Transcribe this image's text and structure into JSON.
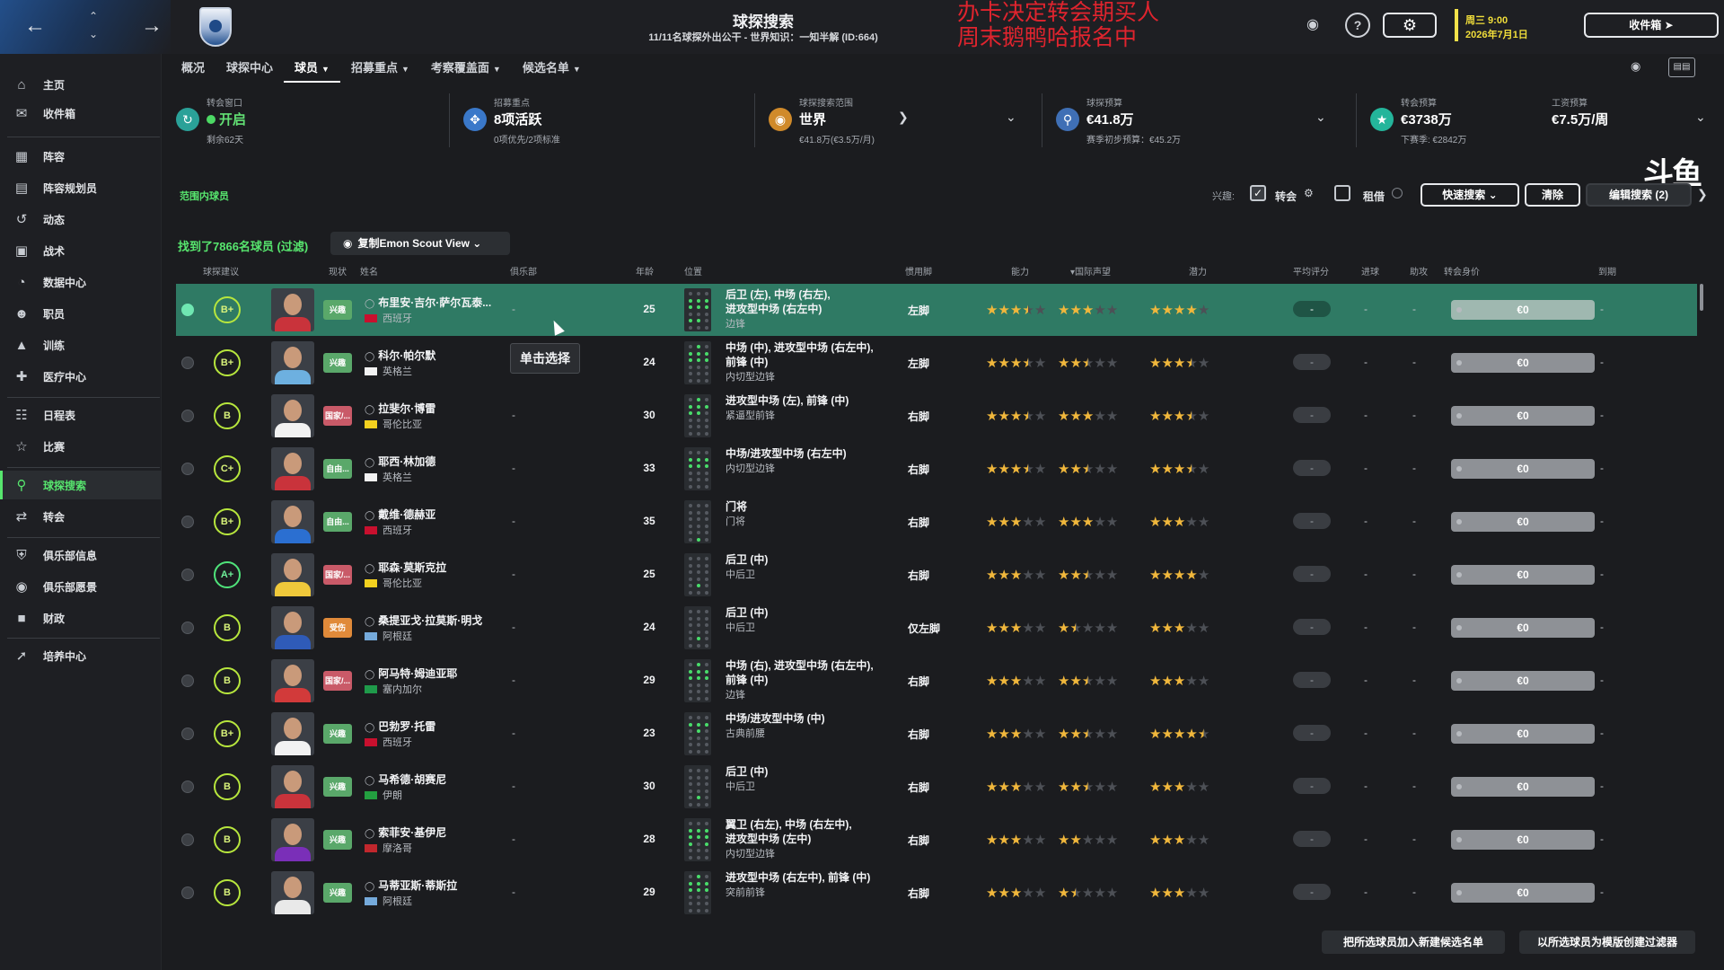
{
  "window": {
    "title": "球探搜索",
    "subtitle": "11/11名球探外出公干 - 世界知识：一知半解 (ID:664)",
    "overlay_line1": "办卡决定转会期买人",
    "overlay_line2": "周末鹅鸭哈报名中",
    "date_line1": "周三 9:00",
    "date_line2": "2026年7月1日",
    "inbox_label": "收件箱"
  },
  "sidebar": {
    "items": [
      {
        "label": "主页",
        "icon": "home-icon"
      },
      {
        "label": "收件箱",
        "icon": "inbox-icon"
      },
      {
        "label": "阵容",
        "icon": "squad-icon"
      },
      {
        "label": "阵容规划员",
        "icon": "planner-icon"
      },
      {
        "label": "动态",
        "icon": "dynamics-icon"
      },
      {
        "label": "战术",
        "icon": "tactics-icon"
      },
      {
        "label": "数据中心",
        "icon": "data-hub-icon"
      },
      {
        "label": "职员",
        "icon": "staff-icon"
      },
      {
        "label": "训练",
        "icon": "training-icon"
      },
      {
        "label": "医疗中心",
        "icon": "medical-icon"
      },
      {
        "label": "日程表",
        "icon": "calendar-icon"
      },
      {
        "label": "比赛",
        "icon": "trophy-icon"
      },
      {
        "label": "球探搜索",
        "icon": "search-icon"
      },
      {
        "label": "转会",
        "icon": "transfer-icon"
      },
      {
        "label": "俱乐部信息",
        "icon": "club-info-icon"
      },
      {
        "label": "俱乐部愿景",
        "icon": "vision-icon"
      },
      {
        "label": "财政",
        "icon": "finance-icon"
      },
      {
        "label": "培养中心",
        "icon": "development-icon"
      }
    ]
  },
  "tabs": [
    {
      "label": "概况"
    },
    {
      "label": "球探中心"
    },
    {
      "label": "球员"
    },
    {
      "label": "招募重点"
    },
    {
      "label": "考察覆盖面"
    },
    {
      "label": "候选名单"
    }
  ],
  "cards": {
    "window": {
      "label": "转会窗口",
      "value": "开启",
      "sub": "剩余62天"
    },
    "focus": {
      "label": "招募重点",
      "value": "8项活跃",
      "sub": "0项优先/2项标准"
    },
    "range": {
      "label": "球探搜索范围",
      "value": "世界",
      "sub": "€41.8万(€3.5万/月)"
    },
    "budget": {
      "label": "球探预算",
      "value": "€41.8万",
      "sub": "赛季初步预算：€45.2万"
    },
    "transfer": {
      "label": "转会预算",
      "value": "€3738万",
      "sub": "下赛季: €2842万"
    },
    "wage": {
      "label": "工资预算",
      "value": "€7.5万/周"
    }
  },
  "filters": {
    "range_label": "范围内球员",
    "interest_label": "兴趣:",
    "transfer_label": "转会",
    "loan_label": "租借",
    "quick_search": "快速搜索",
    "clear": "清除",
    "edit_search": "编辑搜索 (2)",
    "watermark": "斗鱼"
  },
  "results": {
    "found": "找到了7866名球员 (过滤)",
    "view": "复制Emon Scout View"
  },
  "columns": {
    "rec": "球探建议",
    "status": "现状",
    "name": "姓名",
    "club": "俱乐部",
    "age": "年龄",
    "position": "位置",
    "foot": "惯用脚",
    "ability": "能力",
    "reputation": "国际声望",
    "potential": "潜力",
    "avg": "平均评分",
    "goals": "进球",
    "assists": "助攻",
    "value": "转会身价",
    "expires": "到期"
  },
  "players": [
    {
      "rec": "B+",
      "status": "兴趣",
      "name": "布里安·吉尔·萨尔瓦泰...",
      "nation": "西班牙",
      "club": "-",
      "age": "25",
      "pos": "后卫 (左), 中场 (右左),|进攻型中场 (右左中)",
      "role": "边锋",
      "foot": "左脚",
      "ability": 3.5,
      "rep": 3,
      "pot": 4,
      "avg": "-",
      "goals": "-",
      "assists": "-",
      "value": "€0",
      "exp": "-"
    },
    {
      "rec": "B+",
      "status": "兴趣",
      "name": "科尔·帕尔默",
      "nation": "英格兰",
      "club": "-",
      "age": "24",
      "pos": "中场 (中), 进攻型中场 (右左中),|前锋 (中)",
      "role": "内切型边锋",
      "foot": "左脚",
      "ability": 3.5,
      "rep": 2.5,
      "pot": 3.5,
      "avg": "-",
      "goals": "-",
      "assists": "-",
      "value": "€0",
      "exp": "-"
    },
    {
      "rec": "B",
      "status": "国家/...",
      "name": "拉斐尔·博雷",
      "nation": "哥伦比亚",
      "club": "-",
      "age": "30",
      "pos": "进攻型中场 (左), 前锋 (中)",
      "role": "紧逼型前锋",
      "foot": "右脚",
      "ability": 3.5,
      "rep": 3,
      "pot": 3.5,
      "avg": "-",
      "goals": "-",
      "assists": "-",
      "value": "€0",
      "exp": "-"
    },
    {
      "rec": "C+",
      "status": "自由...",
      "name": "耶西·林加德",
      "nation": "英格兰",
      "club": "-",
      "age": "33",
      "pos": "中场/进攻型中场 (右左中)",
      "role": "内切型边锋",
      "foot": "右脚",
      "ability": 3.5,
      "rep": 2.5,
      "pot": 3.5,
      "avg": "-",
      "goals": "-",
      "assists": "-",
      "value": "€0",
      "exp": "-"
    },
    {
      "rec": "B+",
      "status": "自由...",
      "name": "戴维·德赫亚",
      "nation": "西班牙",
      "club": "-",
      "age": "35",
      "pos": "门将",
      "role": "门将",
      "foot": "右脚",
      "ability": 3,
      "rep": 3,
      "pot": 3,
      "avg": "-",
      "goals": "-",
      "assists": "-",
      "value": "€0",
      "exp": "-"
    },
    {
      "rec": "A+",
      "status": "国家/...",
      "name": "耶森·莫斯克拉",
      "nation": "哥伦比亚",
      "club": "-",
      "age": "25",
      "pos": "后卫 (中)",
      "role": "中后卫",
      "foot": "右脚",
      "ability": 3,
      "rep": 2.5,
      "pot": 4,
      "avg": "-",
      "goals": "-",
      "assists": "-",
      "value": "€0",
      "exp": "-"
    },
    {
      "rec": "B",
      "status": "受伤",
      "name": "桑提亚戈·拉莫斯·明戈",
      "nation": "阿根廷",
      "club": "-",
      "age": "24",
      "pos": "后卫 (中)",
      "role": "中后卫",
      "foot": "仅左脚",
      "ability": 3,
      "rep": 1.5,
      "pot": 3,
      "avg": "-",
      "goals": "-",
      "assists": "-",
      "value": "€0",
      "exp": "-"
    },
    {
      "rec": "B",
      "status": "国家/...",
      "name": "阿马特·姆迪亚耶",
      "nation": "塞内加尔",
      "club": "-",
      "age": "29",
      "pos": "中场 (右), 进攻型中场 (右左中),|前锋 (中)",
      "role": "边锋",
      "foot": "右脚",
      "ability": 3,
      "rep": 2.5,
      "pot": 3,
      "avg": "-",
      "goals": "-",
      "assists": "-",
      "value": "€0",
      "exp": "-"
    },
    {
      "rec": "B+",
      "status": "兴趣",
      "name": "巴勃罗·托雷",
      "nation": "西班牙",
      "club": "-",
      "age": "23",
      "pos": "中场/进攻型中场 (中)",
      "role": "古典前腰",
      "foot": "右脚",
      "ability": 3,
      "rep": 2.5,
      "pot": 4.5,
      "avg": "-",
      "goals": "-",
      "assists": "-",
      "value": "€0",
      "exp": "-"
    },
    {
      "rec": "B",
      "status": "兴趣",
      "name": "马希德·胡赛尼",
      "nation": "伊朗",
      "club": "-",
      "age": "30",
      "pos": "后卫 (中)",
      "role": "中后卫",
      "foot": "右脚",
      "ability": 3,
      "rep": 2.5,
      "pot": 3,
      "avg": "-",
      "goals": "-",
      "assists": "-",
      "value": "€0",
      "exp": "-"
    },
    {
      "rec": "B",
      "status": "兴趣",
      "name": "索菲安·基伊尼",
      "nation": "摩洛哥",
      "club": "-",
      "age": "28",
      "pos": "翼卫 (右左), 中场 (右左中),|进攻型中场 (左中)",
      "role": "内切型边锋",
      "foot": "右脚",
      "ability": 3,
      "rep": 2,
      "pot": 3,
      "avg": "-",
      "goals": "-",
      "assists": "-",
      "value": "€0",
      "exp": "-"
    },
    {
      "rec": "B",
      "status": "兴趣",
      "name": "马蒂亚斯·蒂斯拉",
      "nation": "阿根廷",
      "club": "-",
      "age": "29",
      "pos": "进攻型中场 (右左中), 前锋 (中)",
      "role": "突前前锋",
      "foot": "右脚",
      "ability": 3,
      "rep": 1.5,
      "pot": 3,
      "avg": "-",
      "goals": "-",
      "assists": "-",
      "value": "€0",
      "exp": "-"
    }
  ],
  "tooltip": "单击选择",
  "bottom": {
    "add_shortlist": "把所选球员加入新建候选名单",
    "create_filter": "以所选球员为模版创建过滤器"
  }
}
